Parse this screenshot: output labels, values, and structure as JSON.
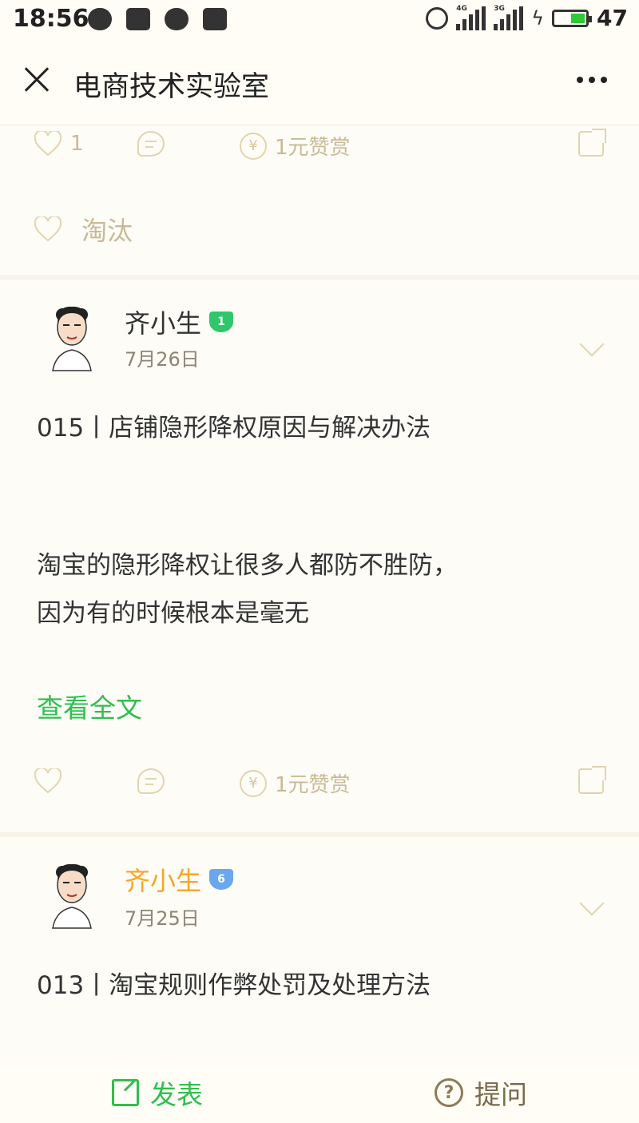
{
  "status_bar": {
    "time": "18:56",
    "battery_percent": "47",
    "battery_level": 0.47,
    "signal_labels": [
      "4G",
      "3G"
    ],
    "icons": [
      "message-icon",
      "qq-icon",
      "wechat-icon",
      "calendar-icon",
      "alarm-icon",
      "signal-icon",
      "charging-icon",
      "battery-icon"
    ]
  },
  "navbar": {
    "title": "电商技术实验室"
  },
  "prev_post": {
    "like_count": "1",
    "reward_label": "1元赞赏",
    "liked_by": "淘汰"
  },
  "posts": [
    {
      "author": "齐小生",
      "badge_level": "1",
      "badge_color": "#2fc76a",
      "author_color": "#333333",
      "date": "7月26日",
      "title": "015丨店铺隐形降权原因与解决办法",
      "body_lines": [
        "淘宝的隐形降权让很多人都防不胜防，",
        "因为有的时候根本是毫无"
      ],
      "read_more": "查看全文",
      "reward_label": "1元赞赏"
    },
    {
      "author": "齐小生",
      "badge_level": "6",
      "badge_color": "#6aa7ee",
      "author_color": "#f5a623",
      "date": "7月25日",
      "title": "013丨淘宝规则作弊处罚及处理方法"
    }
  ],
  "bottom_bar": {
    "publish_label": "发表",
    "ask_label": "提问"
  },
  "colors": {
    "accent_green": "#2fbf4f",
    "muted_gold": "#c9ba96"
  }
}
